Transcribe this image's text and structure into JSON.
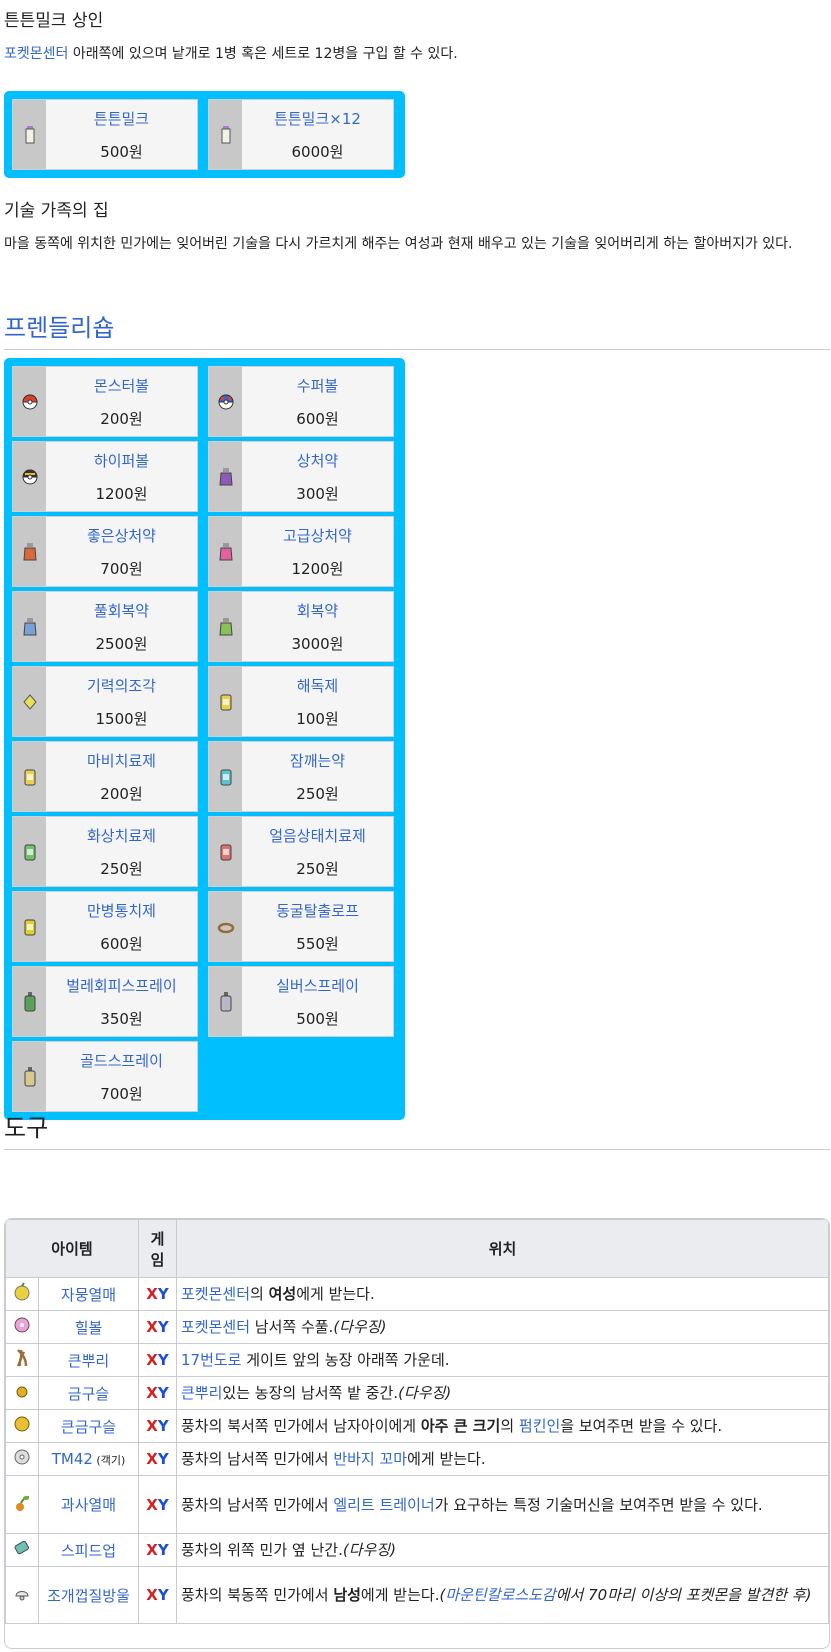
{
  "milk_section": {
    "heading": "튼튼밀크 상인",
    "desc_link": "포켓몬센터",
    "desc_rest": " 아래쪽에 있으며 낱개로 1병 혹은 세트로 12병을 구입 할 수 있다.",
    "items": [
      {
        "name": "튼튼밀크",
        "price": "500원",
        "icon": "milk-bottle-icon"
      },
      {
        "name": "튼튼밀크×12",
        "price": "6000원",
        "icon": "milk-bottle-icon"
      }
    ]
  },
  "move_family": {
    "heading": "기술 가족의 집",
    "desc": "마을 동쪽에 위치한 민가에는 잊어버린 기술을 다시 가르치게 해주는 여성과 현재 배우고 있는 기술을 잊어버리게 하는 할아버지가 있다."
  },
  "friendly_shop": {
    "heading": "프렌들리숍",
    "items": [
      {
        "name": "몬스터볼",
        "price": "200원",
        "icon": "poke-ball-icon"
      },
      {
        "name": "수퍼볼",
        "price": "600원",
        "icon": "great-ball-icon"
      },
      {
        "name": "하이퍼볼",
        "price": "1200원",
        "icon": "ultra-ball-icon"
      },
      {
        "name": "상처약",
        "price": "300원",
        "icon": "potion-icon"
      },
      {
        "name": "좋은상처약",
        "price": "700원",
        "icon": "super-potion-icon"
      },
      {
        "name": "고급상처약",
        "price": "1200원",
        "icon": "hyper-potion-icon"
      },
      {
        "name": "풀회복약",
        "price": "2500원",
        "icon": "full-restore-icon"
      },
      {
        "name": "회복약",
        "price": "3000원",
        "icon": "max-potion-icon"
      },
      {
        "name": "기력의조각",
        "price": "1500원",
        "icon": "revive-icon"
      },
      {
        "name": "해독제",
        "price": "100원",
        "icon": "antidote-icon"
      },
      {
        "name": "마비치료제",
        "price": "200원",
        "icon": "paralyze-heal-icon"
      },
      {
        "name": "잠깨는약",
        "price": "250원",
        "icon": "awakening-icon"
      },
      {
        "name": "화상치료제",
        "price": "250원",
        "icon": "burn-heal-icon"
      },
      {
        "name": "얼음상태치료제",
        "price": "250원",
        "icon": "ice-heal-icon"
      },
      {
        "name": "만병통치제",
        "price": "600원",
        "icon": "full-heal-icon"
      },
      {
        "name": "동굴탈출로프",
        "price": "550원",
        "icon": "escape-rope-icon"
      },
      {
        "name": "벌레회피스프레이",
        "price": "350원",
        "icon": "repel-icon"
      },
      {
        "name": "실버스프레이",
        "price": "500원",
        "icon": "super-repel-icon"
      },
      {
        "name": "골드스프레이",
        "price": "700원",
        "icon": "max-repel-icon"
      }
    ]
  },
  "tools": {
    "heading": "도구",
    "col_item": "아이템",
    "col_game": "게임",
    "col_location": "위치",
    "game_x": "X",
    "game_y": "Y",
    "rows": [
      {
        "name": "자뭉열매",
        "icon": "berry-icon",
        "loc": [
          {
            "t": "포켓몬센터",
            "c": "link"
          },
          {
            "t": "의 "
          },
          {
            "t": "여성",
            "c": "bold"
          },
          {
            "t": "에게 받는다."
          }
        ]
      },
      {
        "name": "힐볼",
        "icon": "heal-ball-icon",
        "loc": [
          {
            "t": "포켓몬센터",
            "c": "link"
          },
          {
            "t": " 남서쪽 수풀."
          },
          {
            "t": "(다우징)",
            "c": "note"
          }
        ]
      },
      {
        "name": "큰뿌리",
        "icon": "big-root-icon",
        "loc": [
          {
            "t": "17번도로",
            "c": "link"
          },
          {
            "t": " 게이트 앞의 농장 아래쪽 가운데."
          }
        ]
      },
      {
        "name": "금구슬",
        "icon": "nugget-icon",
        "loc": [
          {
            "t": "큰뿌리",
            "c": "link"
          },
          {
            "t": "있는 농장의 남서쪽 밭 중간."
          },
          {
            "t": "(다우징)",
            "c": "note"
          }
        ]
      },
      {
        "name": "큰금구슬",
        "icon": "big-nugget-icon",
        "loc": [
          {
            "t": "풍차의 북서쪽 민가에서 남자아이에게 "
          },
          {
            "t": "아주 큰 크기",
            "c": "bold"
          },
          {
            "t": "의 "
          },
          {
            "t": "펌킨인",
            "c": "link"
          },
          {
            "t": "을 보여주면 받을 수 있다."
          }
        ]
      },
      {
        "name": "TM42",
        "small": "(객기)",
        "icon": "tm-disc-icon",
        "loc": [
          {
            "t": "풍차의 남서쪽 민가에서 "
          },
          {
            "t": "반바지 꼬마",
            "c": "link"
          },
          {
            "t": "에게 받는다."
          }
        ]
      },
      {
        "name": "과사열매",
        "icon": "fruit-icon",
        "loc": [
          {
            "t": "풍차의 남서쪽 민가에서 "
          },
          {
            "t": "엘리트 트레이너",
            "c": "link"
          },
          {
            "t": "가 요구하는 특정 기술머신을 보여주면 받을 수 있다."
          }
        ]
      },
      {
        "name": "스피드업",
        "icon": "carbos-icon",
        "loc": [
          {
            "t": "풍차의 위쪽 민가 옆 난간."
          },
          {
            "t": "(다우징)",
            "c": "note"
          }
        ]
      },
      {
        "name": "조개껍질방울",
        "icon": "shell-bell-icon",
        "loc": [
          {
            "t": "풍차의 북동쪽 민가에서 "
          },
          {
            "t": "남성",
            "c": "bold"
          },
          {
            "t": "에게 받는다."
          },
          {
            "t": "(",
            "c": "note"
          },
          {
            "t": "마운틴칼로스도감",
            "c": "note link"
          },
          {
            "t": "에서 70마리 이상의 포켓몬을 발견한 후)",
            "c": "note"
          }
        ]
      }
    ]
  },
  "colors": {
    "shop_bg": "#00bfff",
    "link": "#3366cc",
    "game_x": "#d42020",
    "game_y": "#1a4fd0"
  }
}
